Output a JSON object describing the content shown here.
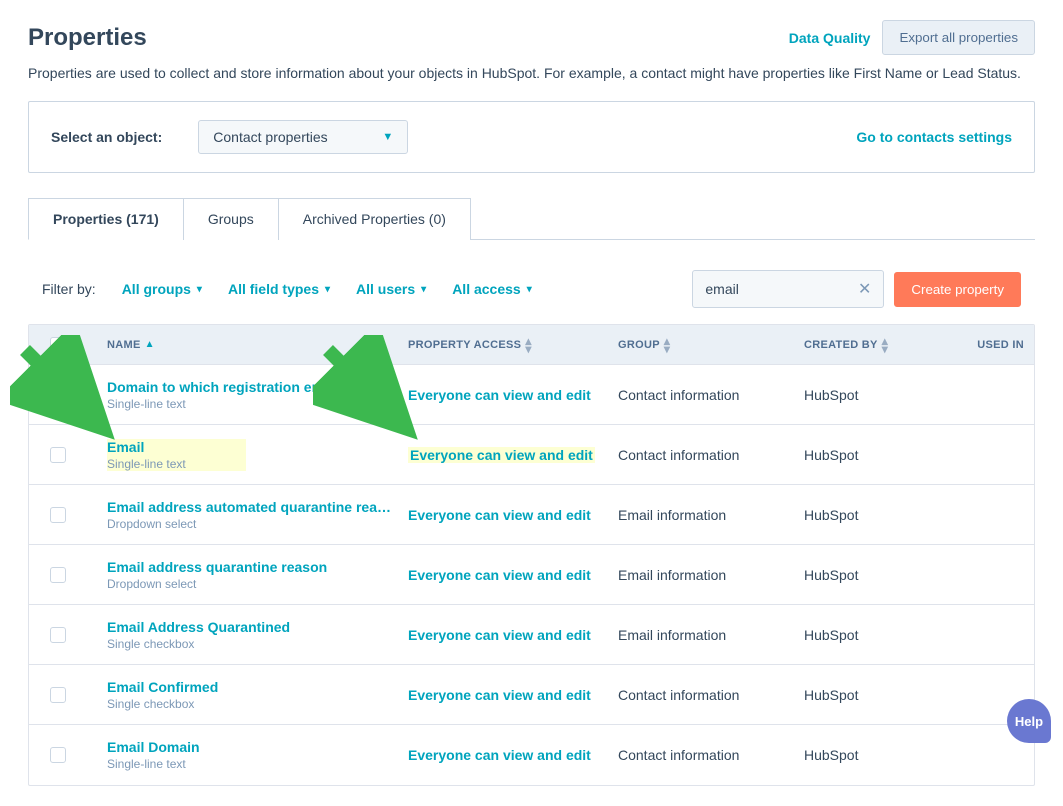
{
  "header": {
    "title": "Properties",
    "data_quality": "Data Quality",
    "export_btn": "Export all properties",
    "description": "Properties are used to collect and store information about your objects in HubSpot. For example, a contact might have properties like First Name or Lead Status."
  },
  "object_select": {
    "label": "Select an object:",
    "value": "Contact properties",
    "settings_link": "Go to contacts settings"
  },
  "tabs": {
    "properties": "Properties (171)",
    "groups": "Groups",
    "archived": "Archived Properties (0)"
  },
  "filters": {
    "label": "Filter by:",
    "groups": "All groups",
    "fieldtypes": "All field types",
    "users": "All users",
    "access": "All access"
  },
  "search": {
    "value": "email"
  },
  "create_btn": "Create property",
  "columns": {
    "name": "NAME",
    "access": "PROPERTY ACCESS",
    "group": "GROUP",
    "created_by": "CREATED BY",
    "used_in": "USED IN"
  },
  "rows": [
    {
      "name": "Domain to which registration email was s…",
      "type": "Single-line text",
      "access": "Everyone can view and edit",
      "group": "Contact information",
      "created_by": "HubSpot",
      "highlight": false
    },
    {
      "name": "Email",
      "type": "Single-line text",
      "access": "Everyone can view and edit",
      "group": "Contact information",
      "created_by": "HubSpot",
      "highlight": true
    },
    {
      "name": "Email address automated quarantine rea…",
      "type": "Dropdown select",
      "access": "Everyone can view and edit",
      "group": "Email information",
      "created_by": "HubSpot",
      "highlight": false
    },
    {
      "name": "Email address quarantine reason",
      "type": "Dropdown select",
      "access": "Everyone can view and edit",
      "group": "Email information",
      "created_by": "HubSpot",
      "highlight": false
    },
    {
      "name": "Email Address Quarantined",
      "type": "Single checkbox",
      "access": "Everyone can view and edit",
      "group": "Email information",
      "created_by": "HubSpot",
      "highlight": false
    },
    {
      "name": "Email Confirmed",
      "type": "Single checkbox",
      "access": "Everyone can view and edit",
      "group": "Contact information",
      "created_by": "HubSpot",
      "highlight": false
    },
    {
      "name": "Email Domain",
      "type": "Single-line text",
      "access": "Everyone can view and edit",
      "group": "Contact information",
      "created_by": "HubSpot",
      "highlight": false
    }
  ],
  "help": "Help"
}
